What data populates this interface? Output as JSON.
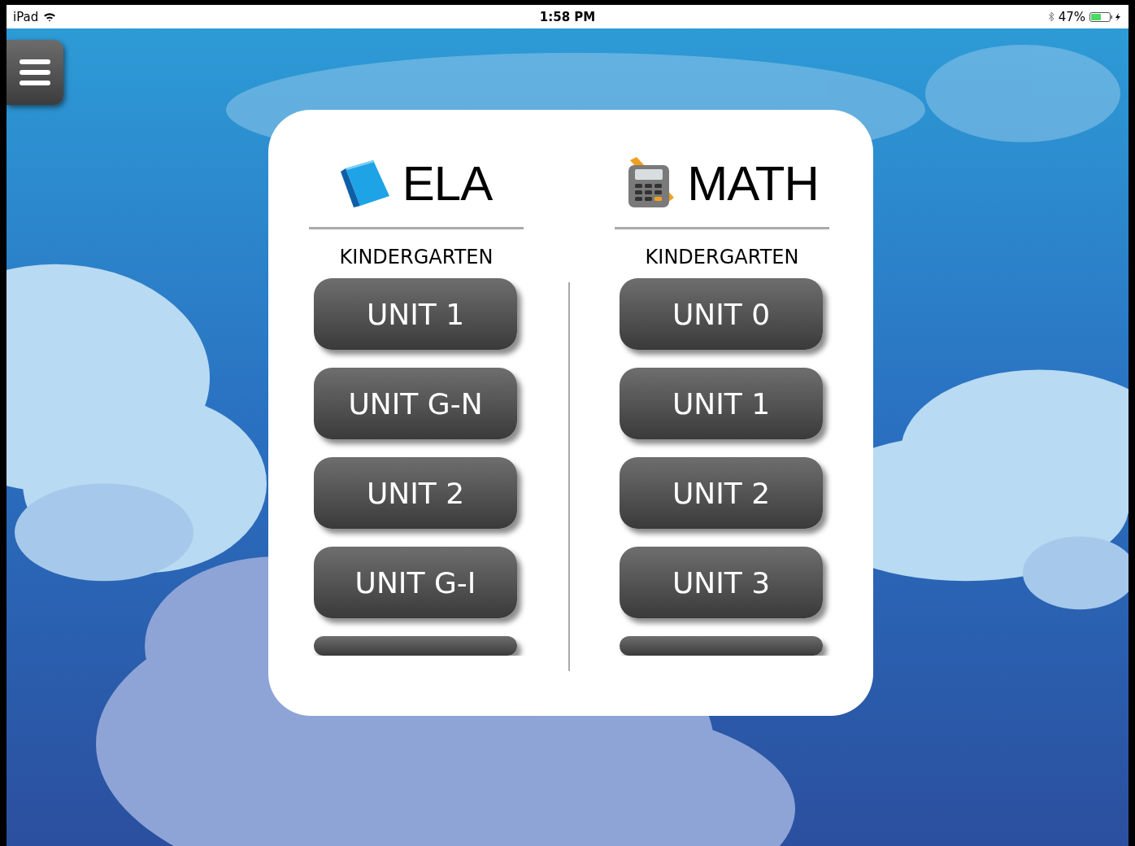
{
  "status_bar": {
    "device": "iPad",
    "time": "1:58 PM",
    "battery": "47%"
  },
  "subjects": [
    {
      "title": "ELA",
      "grade": "KINDERGARTEN",
      "units": [
        "UNIT 1",
        "UNIT G-N",
        "UNIT 2",
        "UNIT G-I"
      ],
      "more_below": true
    },
    {
      "title": "MATH",
      "grade": "KINDERGARTEN",
      "units": [
        "UNIT 0",
        "UNIT 1",
        "UNIT 2",
        "UNIT 3"
      ],
      "more_below": true
    }
  ]
}
